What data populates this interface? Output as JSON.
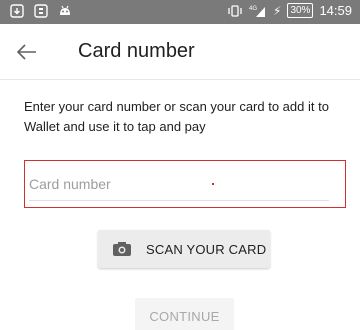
{
  "status_bar": {
    "left_icons": [
      "download-icon",
      "notification-icon",
      "android-icon"
    ],
    "right_icons": [
      "vibrate-icon",
      "signal-4g-icon",
      "charging-icon"
    ],
    "battery": "30%",
    "time": "14:59"
  },
  "app_bar": {
    "title": "Card number",
    "back_icon": "arrow-back-icon"
  },
  "main": {
    "description": "Enter your card number or scan your card to add it to Wallet and use it to tap and pay",
    "card_input": {
      "placeholder": "Card number",
      "value": ""
    },
    "scan_button": {
      "label": "SCAN YOUR CARD",
      "icon": "camera-icon"
    },
    "continue_button": {
      "label": "CONTINUE"
    }
  },
  "colors": {
    "status_bar": "#7a7a7a",
    "error_border": "#d32f2f",
    "button_bg": "#ececec",
    "disabled_text": "#a8a8a8"
  }
}
